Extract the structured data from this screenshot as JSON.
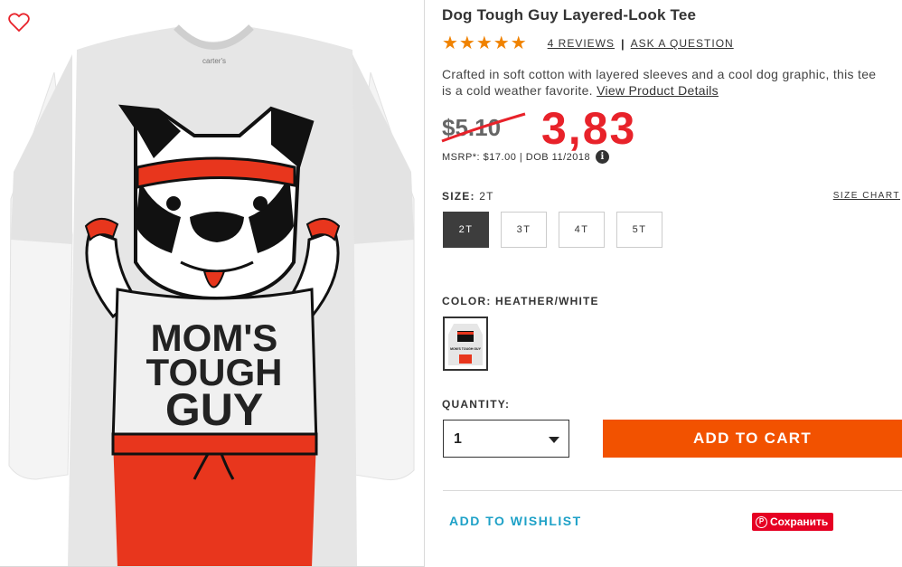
{
  "product": {
    "title": "Dog Tough Guy Layered-Look Tee",
    "stars": "★★★★★",
    "rating": 5,
    "reviews_label": "4 REVIEWS",
    "separator": "|",
    "ask_label": "ASK A QUESTION",
    "description": "Crafted in soft cotton with layered sleeves and a cool dog graphic, this tee is a cold weather favorite.",
    "details_link": "View Product Details",
    "image_text": {
      "brand_tag": "carter's",
      "line1": "MOM'S",
      "line2": "TOUGH",
      "line3": "GUY"
    }
  },
  "price": {
    "old": "$5.10",
    "new": "3,83",
    "msrp": "MSRP*: $17.00 | DOB 11/2018",
    "info_icon": "i"
  },
  "size": {
    "label": "SIZE:",
    "selected": "2T",
    "chart_label": "SIZE CHART",
    "options": [
      "2T",
      "3T",
      "4T",
      "5T"
    ]
  },
  "color": {
    "label": "COLOR: HEATHER/WHITE",
    "swatch_text": "MOM'S TOUGH GUY"
  },
  "quantity": {
    "label": "QUANTITY:",
    "value": "1"
  },
  "actions": {
    "add_to_cart": "ADD TO CART",
    "wishlist": "ADD TO WISHLIST",
    "pinterest": "Сохранить",
    "pin_glyph": "P"
  },
  "colors": {
    "accent_orange": "#f25200",
    "star_orange": "#f08200",
    "price_red": "#e8222a",
    "wishlist_blue": "#1ea1c7",
    "pinterest_red": "#e60023"
  }
}
